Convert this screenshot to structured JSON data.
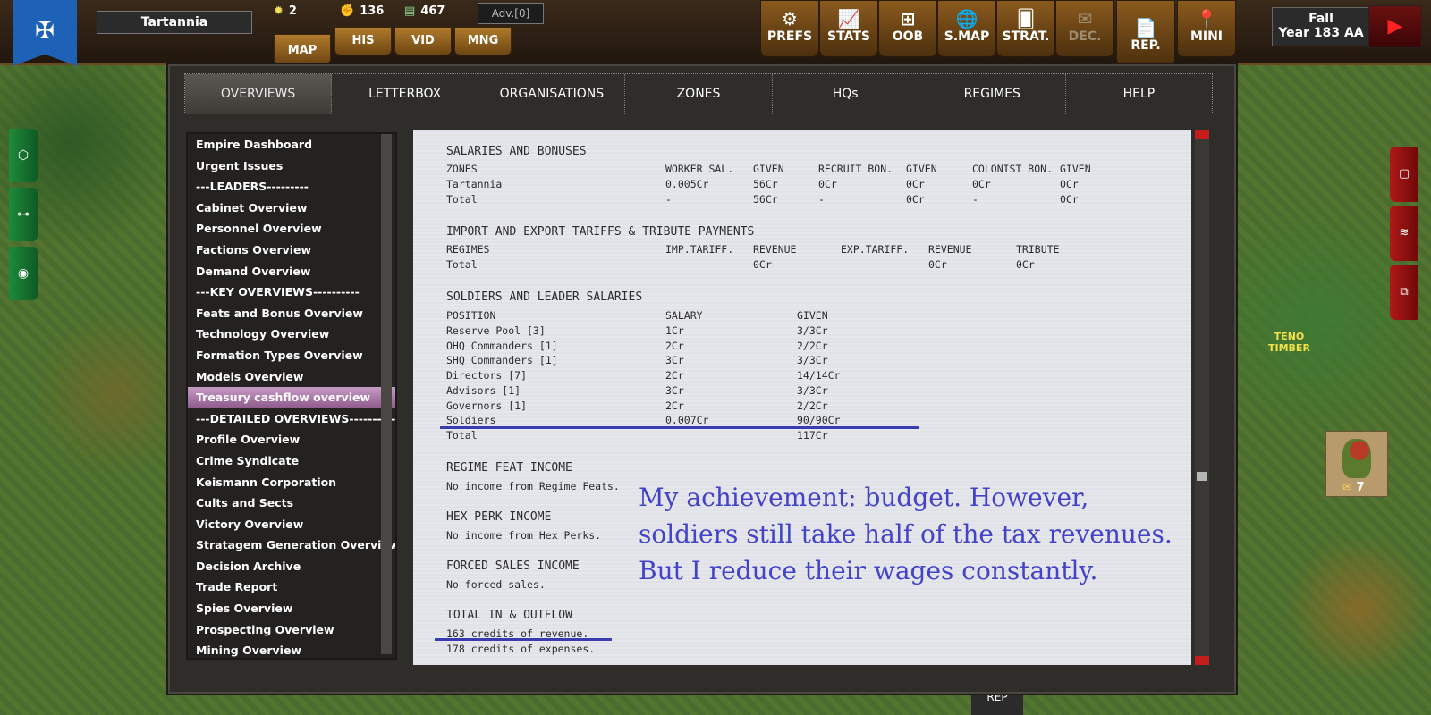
{
  "nation": "Tartannia",
  "resources": [
    {
      "name": "sun-icon",
      "glyph": "✹",
      "value": "2"
    },
    {
      "name": "fist-icon",
      "glyph": "✊",
      "value": "136"
    },
    {
      "name": "money-icon",
      "glyph": "▤",
      "value": "467"
    }
  ],
  "adv": "Adv.[0]",
  "view_tabs": [
    "MAP",
    "HIS",
    "VID",
    "MNG"
  ],
  "top_buttons": [
    {
      "label": "PREFS",
      "icon": "gear-icon",
      "glyph": "⚙",
      "disabled": false
    },
    {
      "label": "STATS",
      "icon": "chart-icon",
      "glyph": "📈",
      "disabled": false
    },
    {
      "label": "OOB",
      "icon": "hierarchy-icon",
      "glyph": "⊞",
      "disabled": false
    },
    {
      "label": "S.MAP",
      "icon": "globe-icon",
      "glyph": "🌐",
      "disabled": false
    },
    {
      "label": "STRAT.",
      "icon": "cards-icon",
      "glyph": "🂠",
      "disabled": false
    },
    {
      "label": "DEC.",
      "icon": "envelope-icon",
      "glyph": "✉",
      "disabled": true
    },
    {
      "label": "REP.",
      "icon": "report-icon",
      "glyph": "📄",
      "disabled": false
    },
    {
      "label": "MINI",
      "icon": "pin-icon",
      "glyph": "📍",
      "disabled": false
    }
  ],
  "season": {
    "line1": "Fall",
    "line2": "Year 183 AA"
  },
  "nav_tabs": [
    "OVERVIEWS",
    "LETTERBOX",
    "ORGANISATIONS",
    "ZONES",
    "HQs",
    "REGIMES",
    "HELP"
  ],
  "sidebar": [
    "Empire Dashboard",
    "Urgent Issues",
    "---LEADERS---------",
    "Cabinet Overview",
    "Personnel Overview",
    "Factions Overview",
    "Demand Overview",
    "---KEY OVERVIEWS----------",
    "Feats and Bonus Overview",
    "Technology Overview",
    "Formation Types Overview",
    "Models Overview",
    "Treasury cashflow overview",
    "---DETAILED OVERVIEWS----------",
    "Profile Overview",
    "Crime Syndicate",
    "Keismann Corporation",
    "Cults and Sects",
    "Victory Overview",
    "Stratagem Generation Overview",
    "Decision Archive",
    "Trade Report",
    "Spies Overview",
    "Prospecting Overview",
    "Mining Overview"
  ],
  "sidebar_selected": "Treasury cashflow overview",
  "doc": {
    "salaries": {
      "title": "SALARIES AND BONUSES",
      "headers": [
        "ZONES",
        "WORKER SAL.",
        "GIVEN",
        "RECRUIT BON.",
        "GIVEN",
        "COLONIST BON.",
        "GIVEN"
      ],
      "rows": [
        [
          "Tartannia",
          "0.005Cr",
          "56Cr",
          "0Cr",
          "0Cr",
          "0Cr",
          "0Cr"
        ],
        [
          "Total",
          "-",
          "56Cr",
          "-",
          "0Cr",
          "-",
          "0Cr"
        ]
      ]
    },
    "tariffs": {
      "title": "IMPORT AND EXPORT TARIFFS & TRIBUTE PAYMENTS",
      "headers": [
        "REGIMES",
        "IMP.TARIFF.",
        "REVENUE",
        "EXP.TARIFF.",
        "REVENUE",
        "TRIBUTE"
      ],
      "rows": [
        [
          "Total",
          "",
          "0Cr",
          "",
          "0Cr",
          "0Cr"
        ]
      ]
    },
    "soldiers": {
      "title": "SOLDIERS AND LEADER SALARIES",
      "headers": [
        "POSITION",
        "SALARY",
        "GIVEN"
      ],
      "rows": [
        [
          "Reserve Pool [3]",
          "1Cr",
          "3/3Cr"
        ],
        [
          "OHQ Commanders [1]",
          "2Cr",
          "2/2Cr"
        ],
        [
          "SHQ Commanders [1]",
          "3Cr",
          "3/3Cr"
        ],
        [
          "Directors [7]",
          "2Cr",
          "14/14Cr"
        ],
        [
          "Advisors [1]",
          "3Cr",
          "3/3Cr"
        ],
        [
          "Governors [1]",
          "2Cr",
          "2/2Cr"
        ],
        [
          "Soldiers",
          "0.007Cr",
          "90/90Cr"
        ],
        [
          "Total",
          "",
          "117Cr"
        ]
      ]
    },
    "feat": {
      "title": "REGIME FEAT INCOME",
      "text": "No income from Regime Feats."
    },
    "hex": {
      "title": "HEX PERK INCOME",
      "text": "No income from Hex Perks."
    },
    "forced": {
      "title": "FORCED SALES INCOME",
      "text": "No forced sales."
    },
    "total": {
      "title": "TOTAL IN & OUTFLOW",
      "revenue": "163 credits of revenue.",
      "expenses": "178 credits of expenses."
    }
  },
  "annotation": "My achievement: budget. However, soldiers still take half of the tax revenues. But I reduce their wages constantly.",
  "map_label": {
    "line1": "TENO",
    "line2": "TIMBER"
  },
  "unit_count": "7",
  "bottom_rep": "REP",
  "colors": {
    "accent": "#4343c8",
    "selected": "#a874a5",
    "nation_flag": "#1e62b8"
  }
}
